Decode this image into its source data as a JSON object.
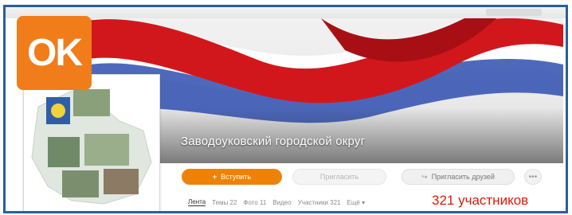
{
  "logo": {
    "text": "OK",
    "color": "#f07d1a"
  },
  "group": {
    "title": "Заводоуковский городской округ"
  },
  "actions": {
    "join_label": "Вступить",
    "invite_label": "Пригласить",
    "friends_label": "Пригласить друзей",
    "more_icon": "ellipsis-icon"
  },
  "tabs": [
    {
      "label": "Лента",
      "active": true
    },
    {
      "label": "Темы 22"
    },
    {
      "label": "Фото 11"
    },
    {
      "label": "Видео"
    },
    {
      "label": "Участники 321"
    },
    {
      "label": "Ещё ▾"
    }
  ],
  "members_count": "321 участников",
  "colors": {
    "accent": "#ee8208",
    "frame": "#2a5f9a",
    "members_text": "#e3170a"
  }
}
